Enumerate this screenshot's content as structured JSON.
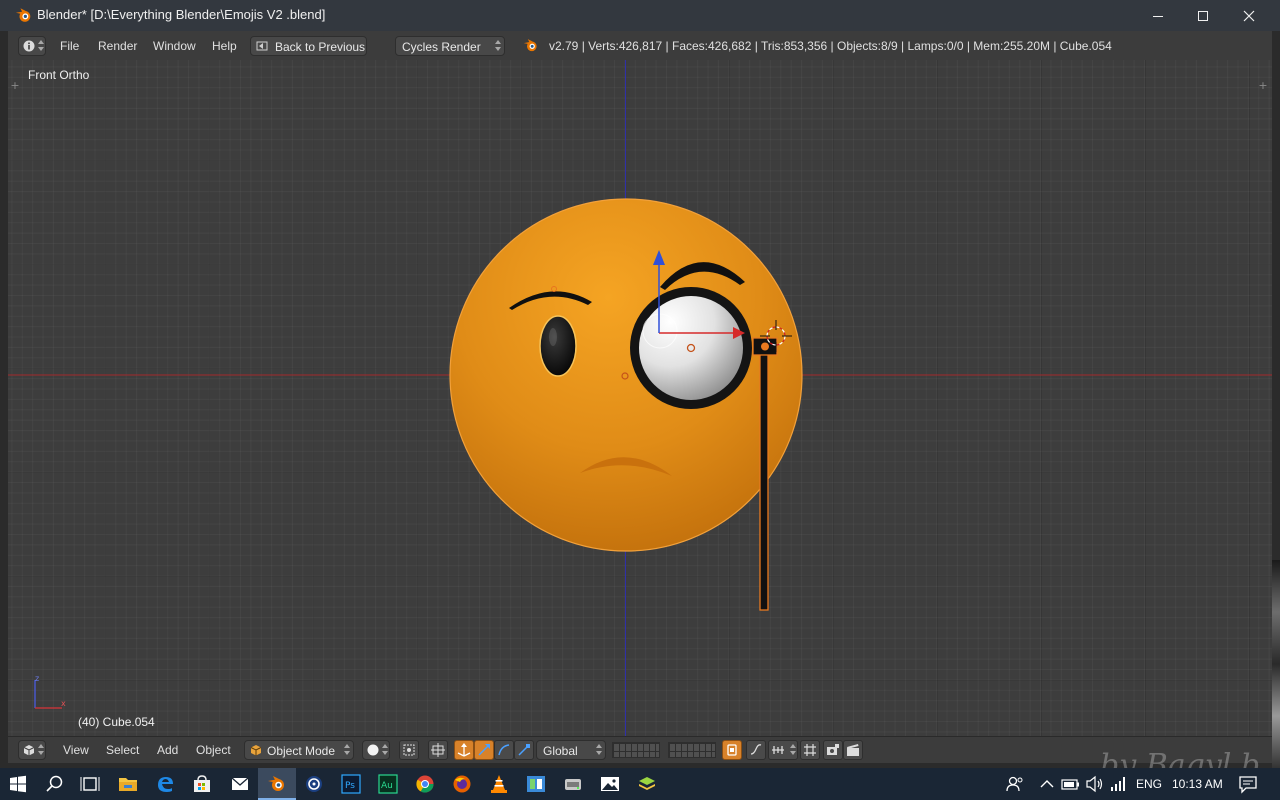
{
  "window": {
    "title": "Blender* [D:\\Everything Blender\\Emojis V2 .blend]",
    "app_icon": "blender-logo-icon",
    "controls": [
      "minimize-icon",
      "maximize-icon",
      "close-icon"
    ]
  },
  "info_header": {
    "editor_type_icon": "info-icon",
    "menus": [
      "File",
      "Render",
      "Window",
      "Help"
    ],
    "back_button": "Back to Previous",
    "render_engine": "Cycles Render",
    "stats": "v2.79 | Verts:426,817 | Faces:426,682 | Tris:853,356 | Objects:8/9 | Lamps:0/0 | Mem:255.20M | Cube.054"
  },
  "viewport": {
    "view_name": "Front Ortho",
    "selected_label": "(40) Cube.054",
    "axis_colors": {
      "x": "#c0282d",
      "z": "#2f2fb8"
    },
    "object_color": "#f0a223"
  },
  "view_header": {
    "editor_type_icon": "3d-view-icon",
    "menus": [
      "View",
      "Select",
      "Add",
      "Object"
    ],
    "mode": "Object Mode",
    "shading_icon": "solid-shading-icon",
    "orientation": "Global"
  },
  "taskbar": {
    "apps": [
      "file-explorer-icon",
      "edge-icon",
      "store-icon",
      "mail-icon",
      "blender-icon",
      "cinema4d-icon",
      "photoshop-icon",
      "audition-icon",
      "chrome-icon",
      "firefox-icon",
      "vlc-icon",
      "mixer-icon",
      "drive-icon",
      "photos-icon",
      "layers-icon"
    ],
    "language": "ENG",
    "time": "10:13 AM",
    "watermark": "by Bagyl b"
  },
  "colors": {
    "accent": "#d8822a",
    "brand": "#ea7600"
  }
}
